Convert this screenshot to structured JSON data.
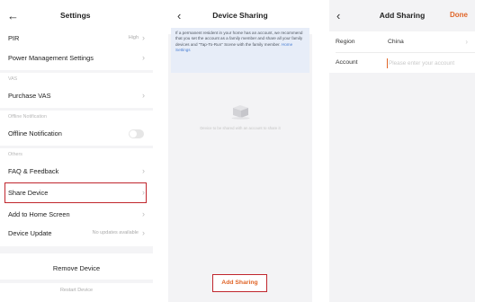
{
  "settings": {
    "title": "Settings",
    "back_icon": "arrow-left-icon",
    "rows": {
      "pir": {
        "label": "PIR",
        "value": "High"
      },
      "power": {
        "label": "Power Management Settings"
      },
      "vas_section": "VAS",
      "purchase_vas": {
        "label": "Purchase VAS"
      },
      "offline_section": "Offline Notification",
      "offline_notification": {
        "label": "Offline Notification",
        "toggle_on": false
      },
      "others_section": "Others",
      "faq": {
        "label": "FAQ & Feedback"
      },
      "share_device": {
        "label": "Share Device"
      },
      "add_home": {
        "label": "Add to Home Screen"
      },
      "device_update": {
        "label": "Device Update",
        "value": "No updates available"
      }
    },
    "remove_device": "Remove Device",
    "restart_device": "Restart Device",
    "highlight_color": "#c0262d"
  },
  "device_sharing": {
    "title": "Device Sharing",
    "info_text": "If a permanent resident in your home has an account, we recommend that you set the account as a family member and share all your family devices and \"Tap-To-Run\" Scene with the family member.",
    "info_link": "Home Settings",
    "empty_text": "Device to be shared with an account to share it",
    "add_button": "Add Sharing"
  },
  "add_sharing": {
    "title": "Add Sharing",
    "done_label": "Done",
    "region_label": "Region",
    "region_value": "China",
    "account_label": "Account",
    "account_placeholder": "Please enter your account",
    "accent": "#e06528"
  }
}
